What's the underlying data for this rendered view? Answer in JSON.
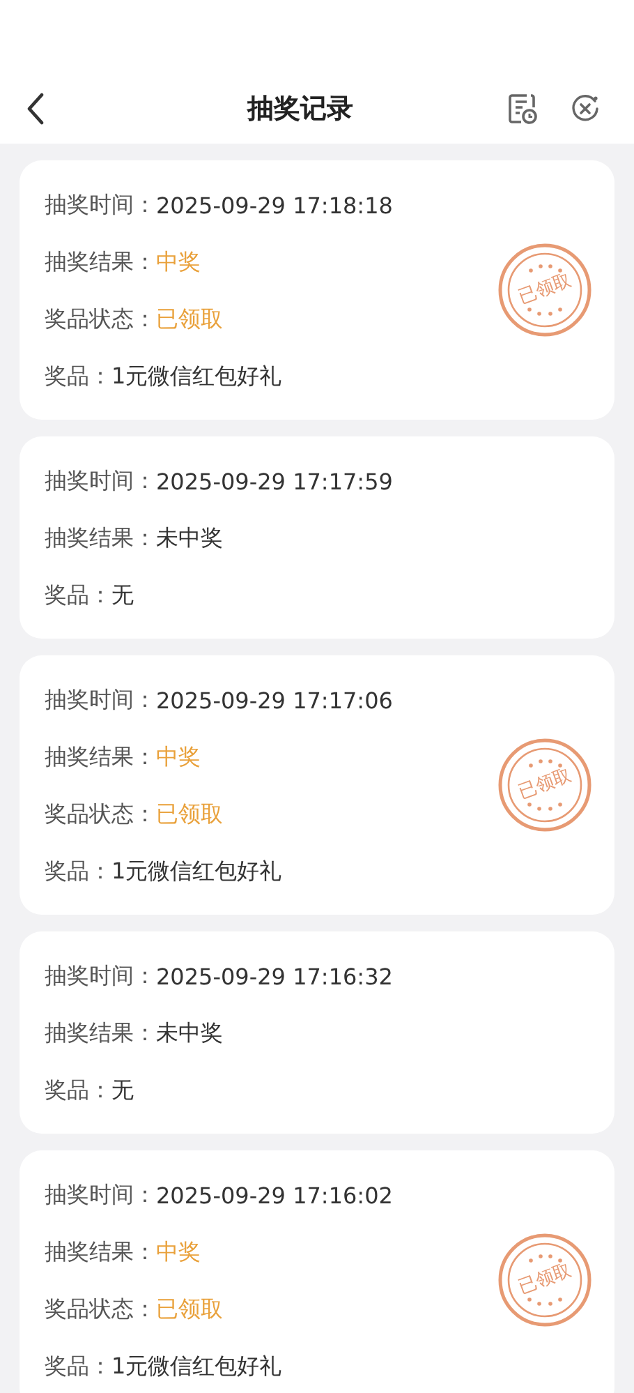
{
  "header": {
    "title": "抽奖记录"
  },
  "records": [
    {
      "rows": [
        {
          "label": "抽奖时间：",
          "value": "2025-09-29 17:18:18",
          "kind": "plain"
        },
        {
          "label": "抽奖结果：",
          "value": "中奖",
          "kind": "highlight"
        },
        {
          "label": "奖品状态：",
          "value": "已领取",
          "kind": "highlight"
        },
        {
          "label": "奖品：",
          "value": "1元微信红包好礼",
          "kind": "plain"
        }
      ],
      "stamp": "已领取"
    },
    {
      "rows": [
        {
          "label": "抽奖时间：",
          "value": "2025-09-29 17:17:59",
          "kind": "plain"
        },
        {
          "label": "抽奖结果：",
          "value": "未中奖",
          "kind": "plain"
        },
        {
          "label": "奖品：",
          "value": "无",
          "kind": "plain"
        }
      ]
    },
    {
      "rows": [
        {
          "label": "抽奖时间：",
          "value": "2025-09-29 17:17:06",
          "kind": "plain"
        },
        {
          "label": "抽奖结果：",
          "value": "中奖",
          "kind": "highlight"
        },
        {
          "label": "奖品状态：",
          "value": "已领取",
          "kind": "highlight"
        },
        {
          "label": "奖品：",
          "value": "1元微信红包好礼",
          "kind": "plain"
        }
      ],
      "stamp": "已领取"
    },
    {
      "rows": [
        {
          "label": "抽奖时间：",
          "value": "2025-09-29 17:16:32",
          "kind": "plain"
        },
        {
          "label": "抽奖结果：",
          "value": "未中奖",
          "kind": "plain"
        },
        {
          "label": "奖品：",
          "value": "无",
          "kind": "plain"
        }
      ]
    },
    {
      "rows": [
        {
          "label": "抽奖时间：",
          "value": "2025-09-29 17:16:02",
          "kind": "plain"
        },
        {
          "label": "抽奖结果：",
          "value": "中奖",
          "kind": "highlight"
        },
        {
          "label": "奖品状态：",
          "value": "已领取",
          "kind": "highlight"
        },
        {
          "label": "奖品：",
          "value": "1元微信红包好礼",
          "kind": "plain"
        }
      ],
      "stamp": "已领取"
    }
  ]
}
